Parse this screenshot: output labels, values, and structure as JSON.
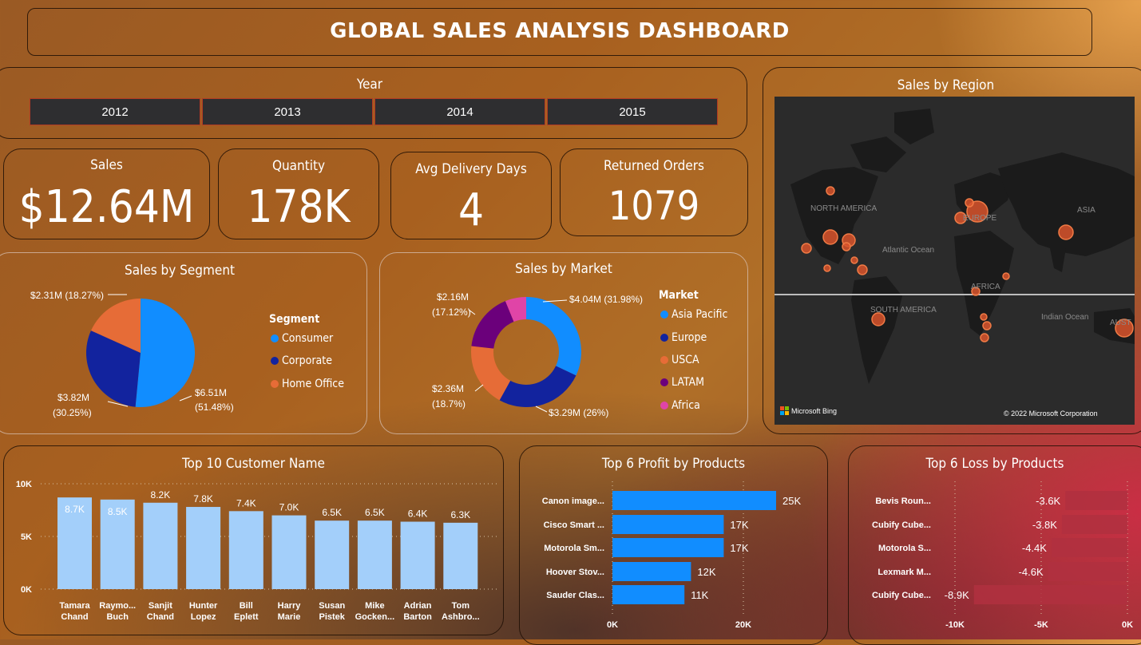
{
  "title": "GLOBAL SALES ANALYSIS DASHBOARD",
  "year_slicer": {
    "title": "Year",
    "options": [
      "2012",
      "2013",
      "2014",
      "2015"
    ]
  },
  "kpis": {
    "sales": {
      "label": "Sales",
      "value": "$12.64M"
    },
    "quantity": {
      "label": "Quantity",
      "value": "178K"
    },
    "delivery": {
      "label": "Avg Delivery Days",
      "value": "4"
    },
    "returned": {
      "label": "Returned Orders",
      "value": "1079"
    }
  },
  "colors": {
    "consumer": "#118dff",
    "corporate": "#12239e",
    "home_office": "#e66c37",
    "latam": "#6b007b",
    "africa": "#e044a7",
    "customer_bars": "#a3cffa",
    "profit_bars": "#118dff",
    "loss_bars": "#b03040"
  },
  "segment": {
    "title": "Sales by Segment",
    "legend_title": "Segment",
    "legend": [
      "Consumer",
      "Corporate",
      "Home Office"
    ],
    "labels": {
      "consumer_a": "$6.51M",
      "consumer_b": "(51.48%)",
      "corporate_a": "$3.82M",
      "corporate_b": "(30.25%)",
      "home_office": "$2.31M (18.27%)"
    }
  },
  "market": {
    "title": "Sales by Market",
    "legend_title": "Market",
    "legend": [
      "Asia Pacific",
      "Europe",
      "USCA",
      "LATAM",
      "Africa"
    ],
    "labels": {
      "asia": "$4.04M (31.98%)",
      "europe": "$3.29M (26%)",
      "usca_a": "$2.36M",
      "usca_b": "(18.7%)",
      "latam_a": "$2.16M",
      "latam_b": "(17.12%)"
    }
  },
  "region_map": {
    "title": "Sales by Region",
    "labels": {
      "north_america": "NORTH AMERICA",
      "europe": "EUROPE",
      "asia": "ASIA",
      "atlantic": "Atlantic Ocean",
      "africa": "AFRICA",
      "south_america": "SOUTH AMERICA",
      "indian": "Indian Ocean",
      "australia": "AUST"
    },
    "bing": "Microsoft Bing",
    "copyright": "© 2022 Microsoft Corporation"
  },
  "customers": {
    "title": "Top 10 Customer Name",
    "ticks": [
      "10K",
      "5K",
      "0K"
    ],
    "bars": [
      {
        "n1": "Tamara",
        "n2": "Chand",
        "label": "8.7K"
      },
      {
        "n1": "Raymo...",
        "n2": "Buch",
        "label": "8.5K"
      },
      {
        "n1": "Sanjit",
        "n2": "Chand",
        "label": "8.2K"
      },
      {
        "n1": "Hunter",
        "n2": "Lopez",
        "label": "7.8K"
      },
      {
        "n1": "Bill",
        "n2": "Eplett",
        "label": "7.4K"
      },
      {
        "n1": "Harry",
        "n2": "Marie",
        "label": "7.0K"
      },
      {
        "n1": "Susan",
        "n2": "Pistek",
        "label": "6.5K"
      },
      {
        "n1": "Mike",
        "n2": "Gocken...",
        "label": "6.5K"
      },
      {
        "n1": "Adrian",
        "n2": "Barton",
        "label": "6.4K"
      },
      {
        "n1": "Tom",
        "n2": "Ashbro...",
        "label": "6.3K"
      }
    ]
  },
  "profit": {
    "title": "Top 6 Profit by Products",
    "ticks": [
      "0K",
      "20K"
    ],
    "bars": [
      {
        "name": "Canon image...",
        "label": "25K"
      },
      {
        "name": "Cisco Smart ...",
        "label": "17K"
      },
      {
        "name": "Motorola Sm...",
        "label": "17K"
      },
      {
        "name": "Hoover Stov...",
        "label": "12K"
      },
      {
        "name": "Sauder Clas...",
        "label": "11K"
      }
    ]
  },
  "loss": {
    "title": "Top 6 Loss by Products",
    "ticks": [
      "-10K",
      "-5K",
      "0K"
    ],
    "bars": [
      {
        "name": "Bevis Roun...",
        "label": "-3.6K"
      },
      {
        "name": "Cubify Cube...",
        "label": "-3.8K"
      },
      {
        "name": "Motorola S...",
        "label": "-4.4K"
      },
      {
        "name": "Lexmark M...",
        "label": "-4.6K"
      },
      {
        "name": "Cubify Cube...",
        "label": "-8.9K"
      }
    ]
  },
  "chart_data": [
    {
      "type": "pie",
      "title": "Sales by Segment",
      "categories": [
        "Consumer",
        "Corporate",
        "Home Office"
      ],
      "values": [
        6.51,
        3.82,
        2.31
      ],
      "percent": [
        51.48,
        30.25,
        18.27
      ],
      "legend": "right"
    },
    {
      "type": "pie",
      "title": "Sales by Market",
      "categories": [
        "Asia Pacific",
        "Europe",
        "USCA",
        "LATAM",
        "Africa"
      ],
      "values": [
        4.04,
        3.29,
        2.36,
        2.16,
        0.78
      ],
      "percent": [
        31.98,
        26.0,
        18.7,
        17.12,
        6.2
      ],
      "legend": "right"
    },
    {
      "type": "bar",
      "title": "Top 10 Customer Name",
      "categories": [
        "Tamara Chand",
        "Raymo... Buch",
        "Sanjit Chand",
        "Hunter Lopez",
        "Bill Eplett",
        "Harry Marie",
        "Susan Pistek",
        "Mike Gocken...",
        "Adrian Barton",
        "Tom Ashbro..."
      ],
      "values": [
        8.7,
        8.5,
        8.2,
        7.8,
        7.4,
        7.0,
        6.5,
        6.5,
        6.4,
        6.3
      ],
      "ylim": [
        0,
        10
      ]
    },
    {
      "type": "bar",
      "title": "Top 6 Profit by Products",
      "categories": [
        "Canon image...",
        "Cisco Smart ...",
        "Motorola Sm...",
        "Hoover Stov...",
        "Sauder Clas..."
      ],
      "values": [
        25,
        17,
        17,
        12,
        11
      ],
      "xlim": [
        0,
        30
      ]
    },
    {
      "type": "bar",
      "title": "Top 6 Loss by Products",
      "categories": [
        "Bevis Roun...",
        "Cubify Cube...",
        "Motorola S...",
        "Lexmark M...",
        "Cubify Cube..."
      ],
      "values": [
        -3.6,
        -3.8,
        -4.4,
        -4.6,
        -8.9
      ],
      "xlim": [
        -10,
        0
      ]
    }
  ]
}
